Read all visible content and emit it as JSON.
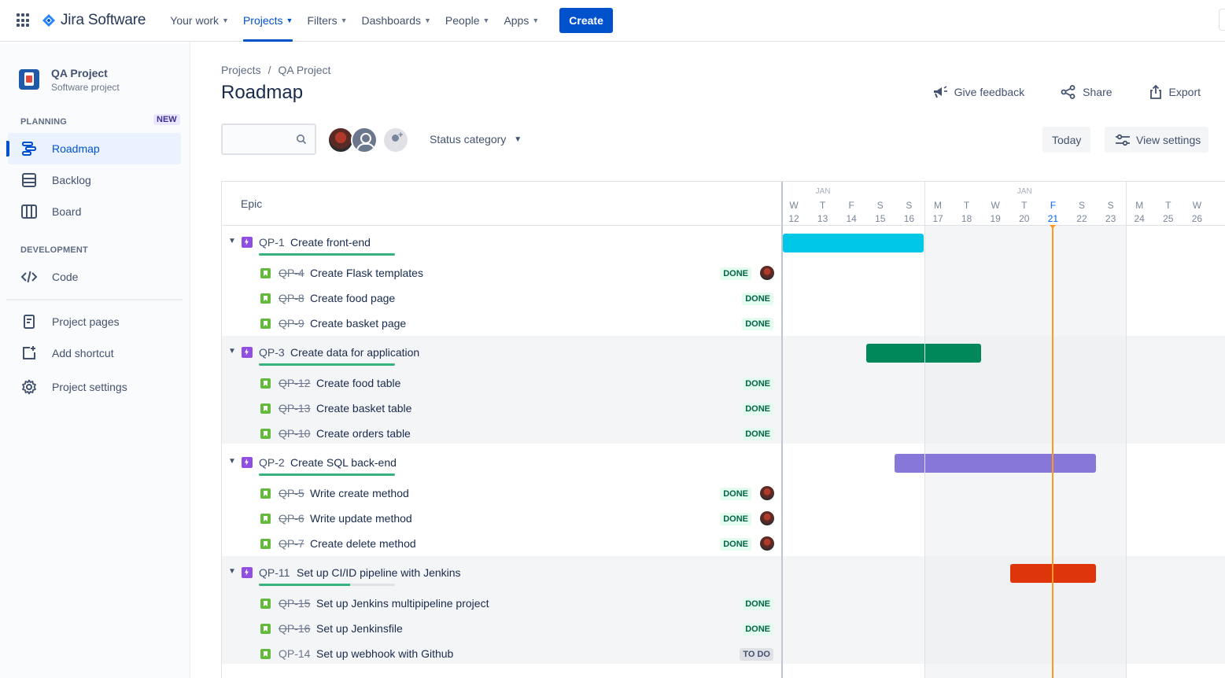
{
  "app": {
    "name": "Jira Software",
    "nav": [
      {
        "label": "Your work"
      },
      {
        "label": "Projects"
      },
      {
        "label": "Filters"
      },
      {
        "label": "Dashboards"
      },
      {
        "label": "People"
      },
      {
        "label": "Apps"
      }
    ],
    "create_label": "Create",
    "accent": "#0052cc"
  },
  "sidebar": {
    "project_name": "QA Project",
    "project_type": "Software project",
    "planning_label": "PLANNING",
    "new_badge": "NEW",
    "development_label": "DEVELOPMENT",
    "items": [
      {
        "label": "Roadmap",
        "icon": "roadmap-icon",
        "active": true
      },
      {
        "label": "Backlog",
        "icon": "backlog-icon"
      },
      {
        "label": "Board",
        "icon": "board-icon"
      },
      {
        "label": "Code",
        "icon": "code-icon"
      },
      {
        "label": "Project pages",
        "icon": "pages-icon"
      },
      {
        "label": "Add shortcut",
        "icon": "add-shortcut-icon"
      },
      {
        "label": "Project settings",
        "icon": "gear-icon"
      }
    ]
  },
  "header": {
    "breadcrumb": [
      "Projects",
      "/",
      "QA Project"
    ],
    "title": "Roadmap",
    "give_feedback": "Give feedback",
    "share": "Share",
    "export": "Export"
  },
  "toolbar": {
    "search_value": "",
    "status_category": "Status category",
    "today": "Today",
    "view_settings": "View settings"
  },
  "roadmap": {
    "epic_header": "Epic",
    "timeline": {
      "months": [
        "JAN",
        "JAN"
      ],
      "days": [
        {
          "dow": "W",
          "date": "12"
        },
        {
          "dow": "T",
          "date": "13"
        },
        {
          "dow": "F",
          "date": "14"
        },
        {
          "dow": "S",
          "date": "15"
        },
        {
          "dow": "S",
          "date": "16"
        },
        {
          "dow": "M",
          "date": "17"
        },
        {
          "dow": "T",
          "date": "18"
        },
        {
          "dow": "W",
          "date": "19"
        },
        {
          "dow": "T",
          "date": "20"
        },
        {
          "dow": "F",
          "date": "21"
        },
        {
          "dow": "S",
          "date": "22"
        },
        {
          "dow": "S",
          "date": "23"
        },
        {
          "dow": "M",
          "date": "24"
        },
        {
          "dow": "T",
          "date": "25"
        },
        {
          "dow": "W",
          "date": "26"
        }
      ],
      "today_date": "21"
    },
    "epics": [
      {
        "key": "QP-1",
        "title": "Create front-end",
        "progress": 1.0,
        "bar_color": "#00c7e6",
        "bar_start": "12",
        "bar_end": "16",
        "children": [
          {
            "key": "QP-4",
            "title": "Create Flask templates",
            "status": "DONE",
            "assigned": true
          },
          {
            "key": "QP-8",
            "title": "Create food page",
            "status": "DONE",
            "assigned": false
          },
          {
            "key": "QP-9",
            "title": "Create basket page",
            "status": "DONE",
            "assigned": false
          }
        ]
      },
      {
        "key": "QP-3",
        "title": "Create data for application",
        "progress": 1.0,
        "bar_color": "#00875a",
        "bar_start": "15",
        "bar_end": "18",
        "children": [
          {
            "key": "QP-12",
            "title": "Create food table",
            "status": "DONE",
            "assigned": false
          },
          {
            "key": "QP-13",
            "title": "Create basket table",
            "status": "DONE",
            "assigned": false
          },
          {
            "key": "QP-10",
            "title": "Create orders table",
            "status": "DONE",
            "assigned": false
          }
        ]
      },
      {
        "key": "QP-2",
        "title": "Create SQL back-end",
        "progress": 1.0,
        "bar_color": "#8777d9",
        "bar_start": "16",
        "bar_end": "22",
        "children": [
          {
            "key": "QP-5",
            "title": "Write create method",
            "status": "DONE",
            "assigned": true
          },
          {
            "key": "QP-6",
            "title": "Write update method",
            "status": "DONE",
            "assigned": true
          },
          {
            "key": "QP-7",
            "title": "Create delete method",
            "status": "DONE",
            "assigned": true
          }
        ]
      },
      {
        "key": "QP-11",
        "title": "Set up CI/ID pipeline with Jenkins",
        "progress": 0.67,
        "bar_color": "#de350b",
        "bar_start": "20",
        "bar_end": "22",
        "children": [
          {
            "key": "QP-15",
            "title": "Set up Jenkins multipipeline project",
            "status": "DONE",
            "assigned": false
          },
          {
            "key": "QP-16",
            "title": "Set up Jenkinsfile",
            "status": "DONE",
            "assigned": false
          },
          {
            "key": "QP-14",
            "title": "Set up webhook with Github",
            "status": "TO DO",
            "assigned": false
          }
        ]
      }
    ]
  }
}
